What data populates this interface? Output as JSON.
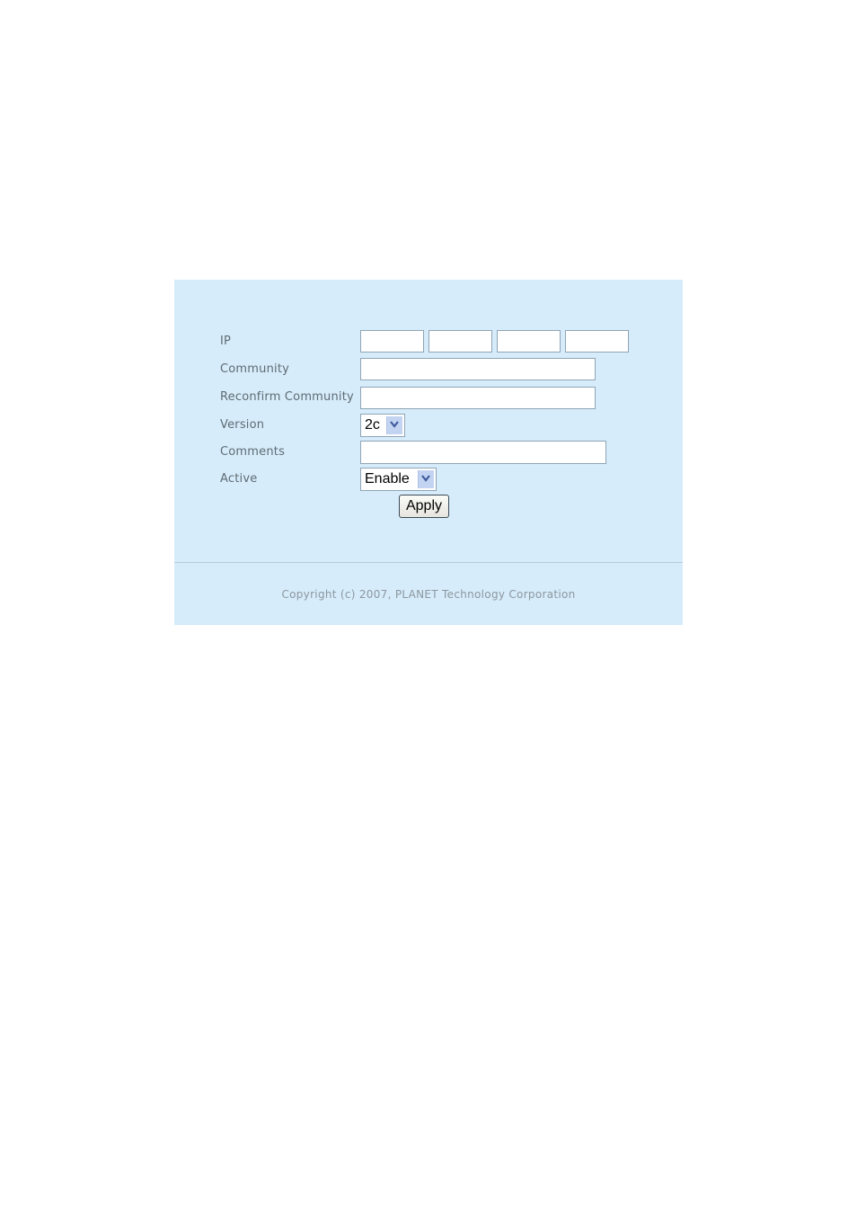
{
  "form": {
    "fields": {
      "ip": {
        "label": "IP",
        "octets": [
          "",
          "",
          "",
          ""
        ]
      },
      "community": {
        "label": "Community",
        "value": ""
      },
      "reconfirm_community": {
        "label": "Reconfirm Community",
        "value": ""
      },
      "version": {
        "label": "Version",
        "selected": "2c"
      },
      "comments": {
        "label": "Comments",
        "value": ""
      },
      "active": {
        "label": "Active",
        "selected": "Enable"
      }
    },
    "apply_label": "Apply"
  },
  "footer": {
    "copyright": "Copyright (c) 2007, PLANET Technology Corporation"
  },
  "icons": {
    "dropdown": "chevron-down-icon"
  }
}
